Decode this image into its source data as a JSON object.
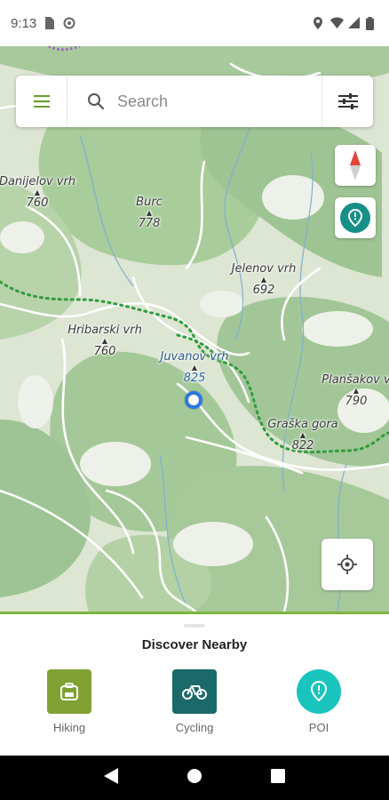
{
  "status_bar": {
    "time": "9:13"
  },
  "search": {
    "placeholder": "Search"
  },
  "map": {
    "peaks": [
      {
        "name": "Danijelov vrh",
        "elevation": "760"
      },
      {
        "name": "Burc",
        "elevation": "778"
      },
      {
        "name": "Jelenov vrh",
        "elevation": "692"
      },
      {
        "name": "Hribarski vrh",
        "elevation": "760"
      },
      {
        "name": "Juvanov vrh",
        "elevation": "825"
      },
      {
        "name": "Planšakov v",
        "elevation": "790"
      },
      {
        "name": "Graška gora",
        "elevation": "822"
      }
    ]
  },
  "sheet": {
    "title": "Discover Nearby",
    "categories": [
      {
        "label": "Hiking",
        "color": "#7fa133",
        "icon": "backpack-icon"
      },
      {
        "label": "Cycling",
        "color": "#1b6a6a",
        "icon": "bicycle-icon"
      },
      {
        "label": "POI",
        "color": "#19c4bd",
        "icon": "poi-marker-icon"
      }
    ]
  },
  "colors": {
    "accent": "#7fb43e",
    "location": "#2b78e4",
    "trail": "#2e9c3c"
  }
}
